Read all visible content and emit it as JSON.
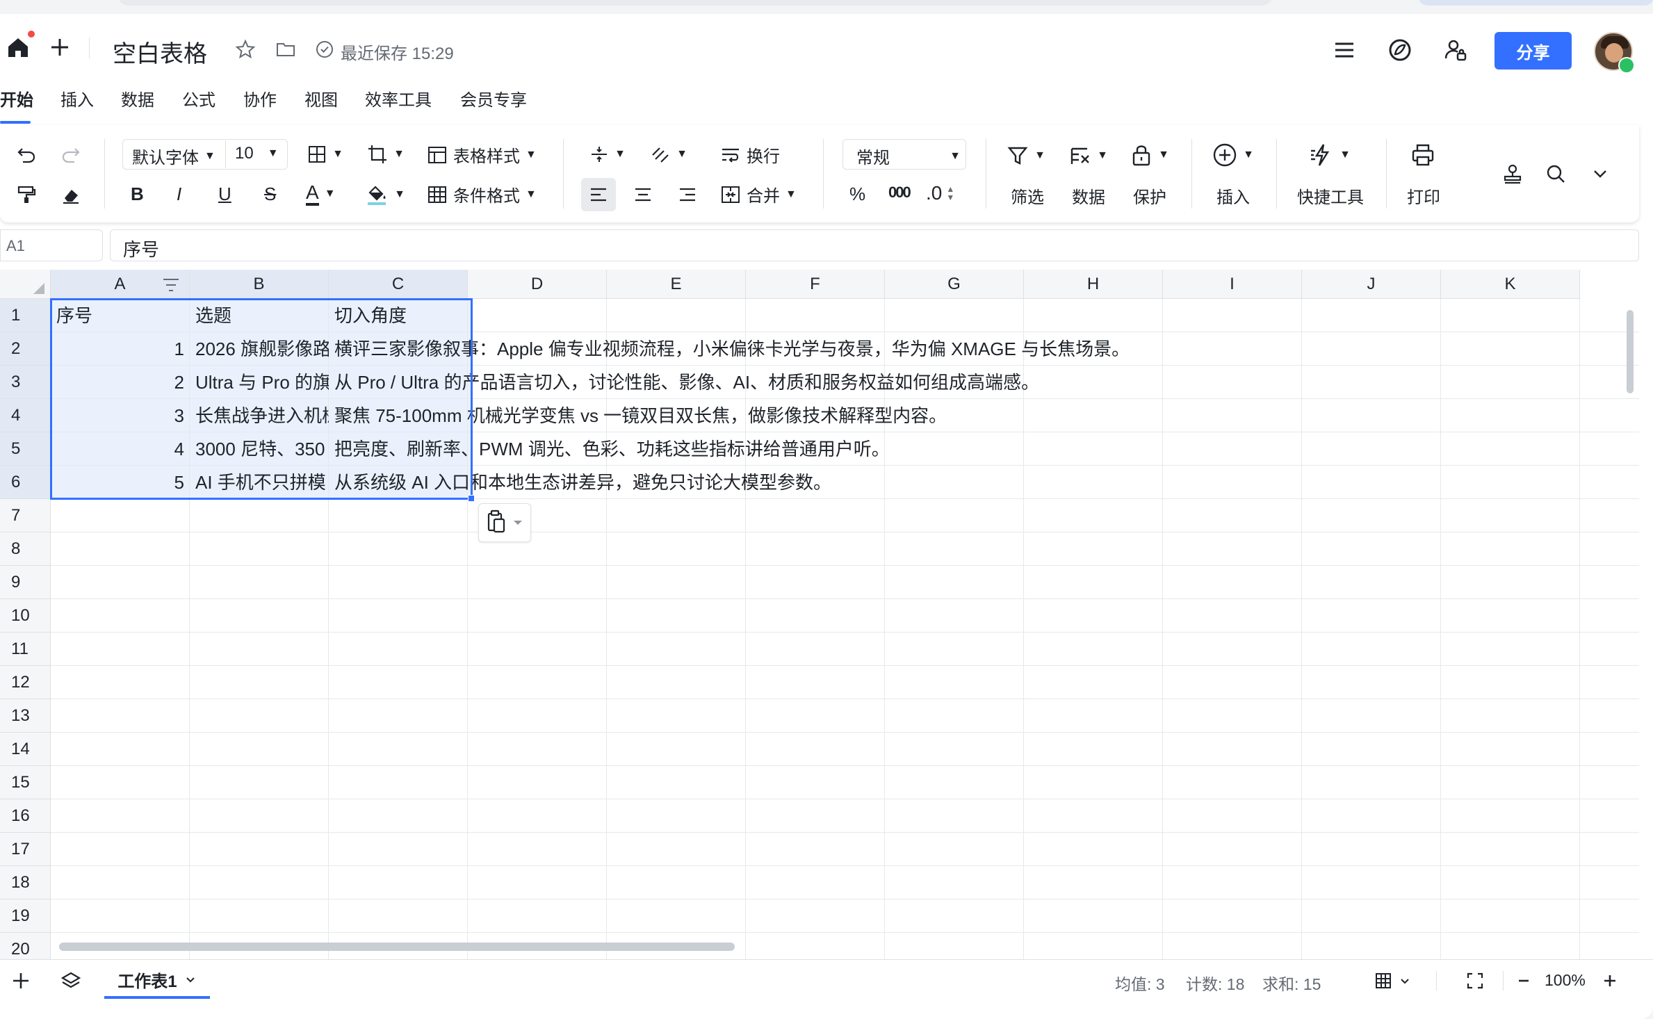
{
  "doc": {
    "title": "空白表格",
    "save_status": "最近保存 15:29",
    "share_label": "分享"
  },
  "menu": [
    "开始",
    "插入",
    "数据",
    "公式",
    "协作",
    "视图",
    "效率工具",
    "会员专享"
  ],
  "toolbar": {
    "font_family": "默认字体",
    "font_size": "10",
    "table_style": "表格样式",
    "cond_format": "条件格式",
    "wrap": "换行",
    "merge": "合并",
    "number_format": "常规",
    "percent": "%",
    "thousands": "000",
    "decimal": ".0",
    "filter": "筛选",
    "data": "数据",
    "protect": "保护",
    "insert": "插入",
    "quick_tools": "快捷工具",
    "print": "打印"
  },
  "formula_bar": {
    "cell_ref": "A1",
    "content": "序号"
  },
  "columns": [
    "A",
    "B",
    "C",
    "D",
    "E",
    "F",
    "G",
    "H",
    "I",
    "J",
    "K"
  ],
  "rows": [
    "1",
    "2",
    "3",
    "4",
    "5",
    "6",
    "7",
    "8",
    "9",
    "10",
    "11",
    "12",
    "13",
    "14",
    "15",
    "16",
    "17",
    "18",
    "19",
    "20"
  ],
  "cells": {
    "header": [
      "序号",
      "选题",
      "切入角度"
    ],
    "data": [
      {
        "a": "1",
        "b": "2026 旗舰影像路",
        "c": "横评三家影像叙事：Apple 偏专业视频流程，小米偏徕卡光学与夜景，华为偏 XMAGE 与长焦场景。"
      },
      {
        "a": "2",
        "b": "Ultra 与 Pro 的旗",
        "c": "从 Pro / Ultra 的产品语言切入，讨论性能、影像、AI、材质和服务权益如何组成高端感。"
      },
      {
        "a": "3",
        "b": "长焦战争进入机械",
        "c": "聚焦 75-100mm 机械光学变焦 vs 一镜双目双长焦，做影像技术解释型内容。"
      },
      {
        "a": "4",
        "b": "3000 尼特、350",
        "c": "把亮度、刷新率、PWM 调光、色彩、功耗这些指标讲给普通用户听。"
      },
      {
        "a": "5",
        "b": "AI 手机不只拼模",
        "c": "从系统级 AI 入口和本地生态讲差异，避免只讨论大模型参数。"
      }
    ]
  },
  "sheet_tab": "工作表1",
  "status": {
    "average": "均值: 3",
    "count": "计数: 18",
    "sum": "求和: 15",
    "zoom": "100%"
  },
  "colors": {
    "accent": "#3370ff",
    "selection_fill": "#eaf1fd",
    "header_bg": "#f5f6f7"
  }
}
